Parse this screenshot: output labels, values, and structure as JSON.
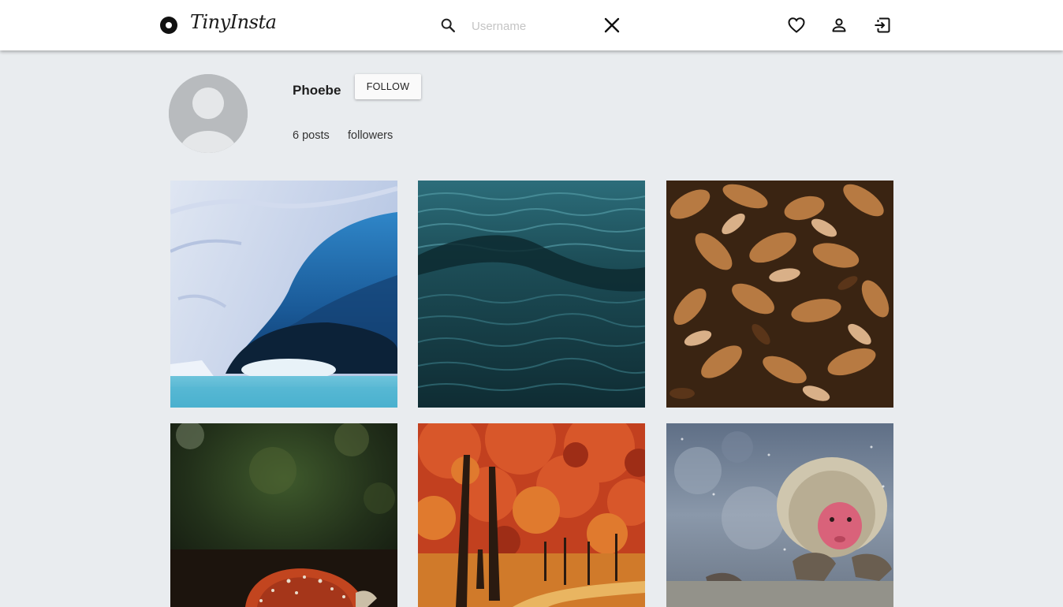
{
  "header": {
    "app_name": "TinyInsta",
    "search": {
      "placeholder": "Username",
      "value": ""
    },
    "icons": [
      "logo-icon",
      "search-icon",
      "close-icon",
      "heart-icon",
      "person-icon",
      "logout-icon"
    ]
  },
  "profile": {
    "username": "Phoebe",
    "follow_label": "FOLLOW",
    "posts_label": "6 posts",
    "followers_label": "followers"
  },
  "posts": [
    {
      "subject": "ice cave"
    },
    {
      "subject": "dark teal ocean water"
    },
    {
      "subject": "dry autumn leaves"
    },
    {
      "subject": "red mushroom in forest"
    },
    {
      "subject": "red autumn forest path"
    },
    {
      "subject": "snow monkey in hot spring"
    }
  ],
  "colors": {
    "page_background": "#e9ecef",
    "header_background": "#ffffff",
    "avatar_grey": "#b8bbbe"
  }
}
